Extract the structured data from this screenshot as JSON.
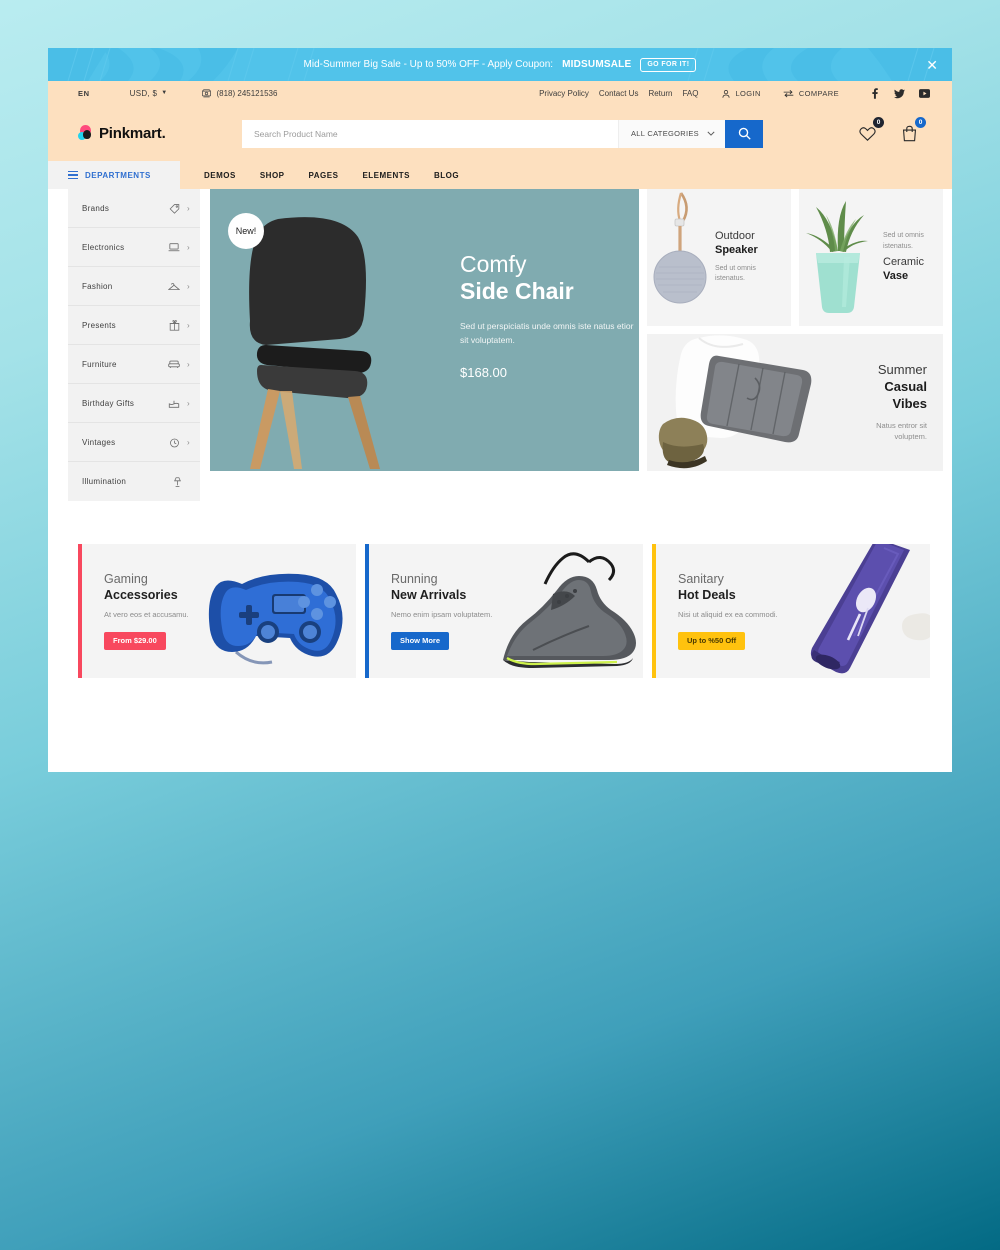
{
  "promo": {
    "text": "Mid-Summer Big Sale - Up to 50% OFF - Apply Coupon: ",
    "coupon": "MIDSUMSALE",
    "button": "GO FOR IT!",
    "close_icon": "close-icon"
  },
  "utility": {
    "language": "EN",
    "currency": "USD, $",
    "phone": "(818) 245121536",
    "links": [
      "Privacy Policy",
      "Contact Us",
      "Return",
      "FAQ"
    ],
    "login": "LOGIN",
    "compare": "COMPARE",
    "social": [
      "facebook-icon",
      "twitter-icon",
      "youtube-icon"
    ]
  },
  "header": {
    "logo_text": "Pinkmart.",
    "search_placeholder": "Search Product Name",
    "search_value": "",
    "categories_label": "ALL CATEGORIES",
    "wishlist_count": "0",
    "cart_count": "0"
  },
  "nav": {
    "departments_label": "DEPARTMENTS",
    "items": [
      "DEMOS",
      "SHOP",
      "PAGES",
      "ELEMENTS",
      "BLOG"
    ]
  },
  "departments": [
    {
      "label": "Brands",
      "icon": "tag-icon",
      "arrow": "›"
    },
    {
      "label": "Electronics",
      "icon": "laptop-icon",
      "arrow": "›"
    },
    {
      "label": "Fashion",
      "icon": "hanger-icon",
      "arrow": "›"
    },
    {
      "label": "Presents",
      "icon": "gift-icon",
      "arrow": "›"
    },
    {
      "label": "Furniture",
      "icon": "sofa-icon",
      "arrow": "›"
    },
    {
      "label": "Birthday Gifts",
      "icon": "cake-icon",
      "arrow": "›"
    },
    {
      "label": "Vintages",
      "icon": "clock-icon",
      "arrow": "›"
    },
    {
      "label": "Illumination",
      "icon": "lamp-icon",
      "arrow": ""
    }
  ],
  "hero": {
    "badge": "New!",
    "title_light": "Comfy",
    "title_bold": "Side Chair",
    "description": "Sed ut perspiciatis unde omnis iste natus etior sit voluptatem.",
    "price": "$168.00"
  },
  "cards": {
    "speaker": {
      "title_light": "Outdoor",
      "title_bold": "Speaker",
      "subtitle": "Sed ut omnis istenatus."
    },
    "vase": {
      "subtitle": "Sed ut omnis istenatus.",
      "title_light": "Ceramic",
      "title_bold": "Vase"
    },
    "summer": {
      "title_light": "Summer",
      "title_bold_1": "Casual",
      "title_bold_2": "Vibes",
      "subtitle": "Natus entror sit voluptem."
    }
  },
  "promo_cards": [
    {
      "title_light": "Gaming",
      "title_bold": "Accessories",
      "subtitle": "At vero eos et accusamu.",
      "button": "From $29.00",
      "accent": "#f8485e"
    },
    {
      "title_light": "Running",
      "title_bold": "New Arrivals",
      "subtitle": "Nemo enim ipsam voluptatem.",
      "button": "Show More",
      "accent": "#1668cb"
    },
    {
      "title_light": "Sanitary",
      "title_bold": "Hot Deals",
      "subtitle": "Nisi ut aliquid ex ea commodi.",
      "button": "Up to %50 Off",
      "accent": "#ffc20e"
    }
  ]
}
